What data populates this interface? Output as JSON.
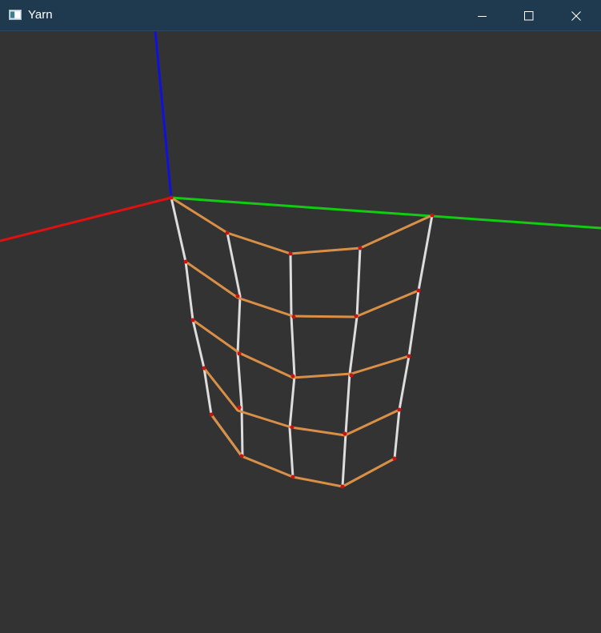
{
  "window": {
    "title": "Yarn",
    "icon": "app-window-icon",
    "controls": {
      "minimize_icon": "minimize-icon",
      "maximize_icon": "maximize-icon",
      "close_icon": "close-icon"
    }
  },
  "colors": {
    "titlebar_bg": "#1f3a4f",
    "viewport_bg": "#333333",
    "axis_x": "#dd1111",
    "axis_y": "#11cc11",
    "axis_z": "#1111dd",
    "course_yarn": "#d99046",
    "wale_yarn": "#dddddd",
    "node": "#cc1111"
  }
}
